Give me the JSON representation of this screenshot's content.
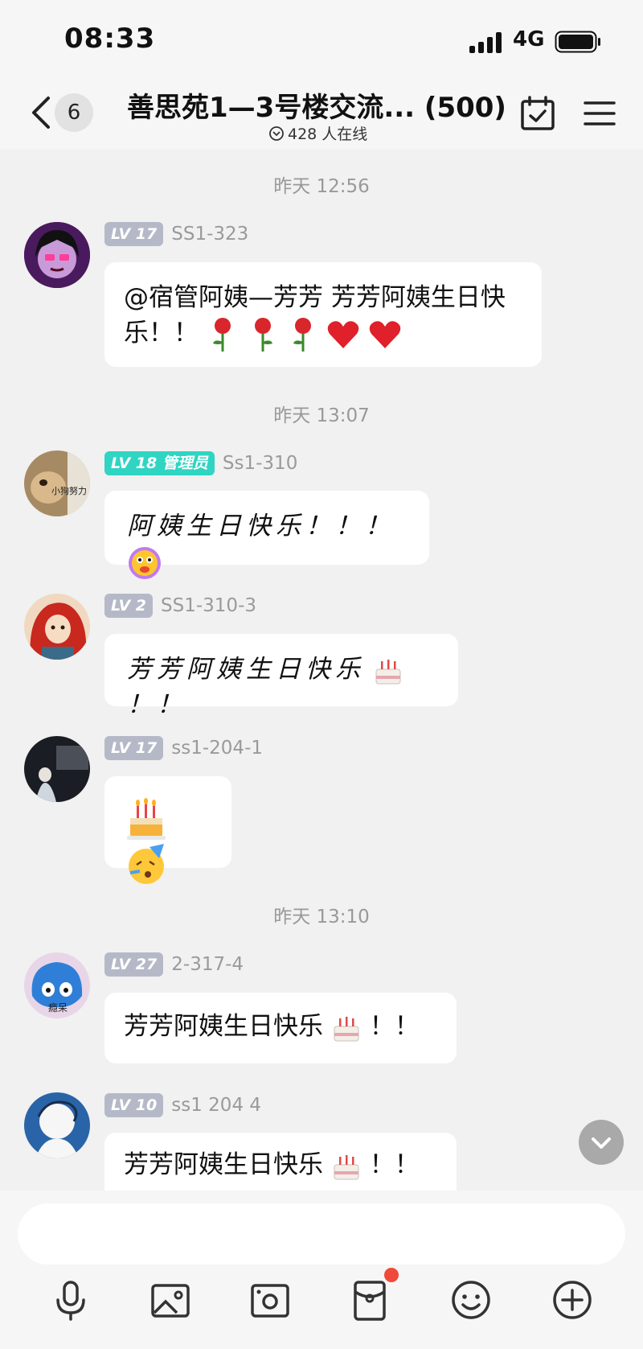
{
  "status_bar": {
    "time": "08:33",
    "network": "4G"
  },
  "header": {
    "unread_count": "6",
    "title": "善思苑1—3号楼交流... (500)",
    "online_text": "428 人在线"
  },
  "messages": [
    {
      "timestamp": "昨天 12:56",
      "level": "LV 17",
      "role": "",
      "username": "SS1-323",
      "text": "@宿管阿姨—芳芳 芳芳阿姨生日快乐！！"
    },
    {
      "timestamp": "昨天 13:07",
      "level": "LV 18",
      "role": "管理员",
      "username": "Ss1-310",
      "text": "阿姨生日快乐！！！"
    },
    {
      "level": "LV 2",
      "role": "",
      "username": "SS1-310-3",
      "text": "芳芳阿姨生日快乐",
      "suffix": "！！"
    },
    {
      "level": "LV 17",
      "role": "",
      "username": "ss1-204-1",
      "text": ""
    },
    {
      "timestamp": "昨天 13:10",
      "level": "LV 27",
      "role": "",
      "username": "2-317-4",
      "text": "芳芳阿姨生日快乐",
      "suffix": "！！"
    },
    {
      "level": "LV 10",
      "role": "",
      "username": "ss1 204 4",
      "text": "芳芳阿姨生日快乐",
      "suffix": "！！"
    }
  ],
  "avatar_labels": {
    "msg2": "小狗努力",
    "msg5": "瘾呆"
  },
  "icons": {
    "toolbar": [
      "microphone-icon",
      "image-icon",
      "camera-icon",
      "red-envelope-icon",
      "emoji-icon",
      "plus-icon"
    ]
  },
  "colors": {
    "admin_badge": "#2fd5c2",
    "level_badge": "#b5b9c7",
    "notify_dot": "#f04a3a"
  }
}
